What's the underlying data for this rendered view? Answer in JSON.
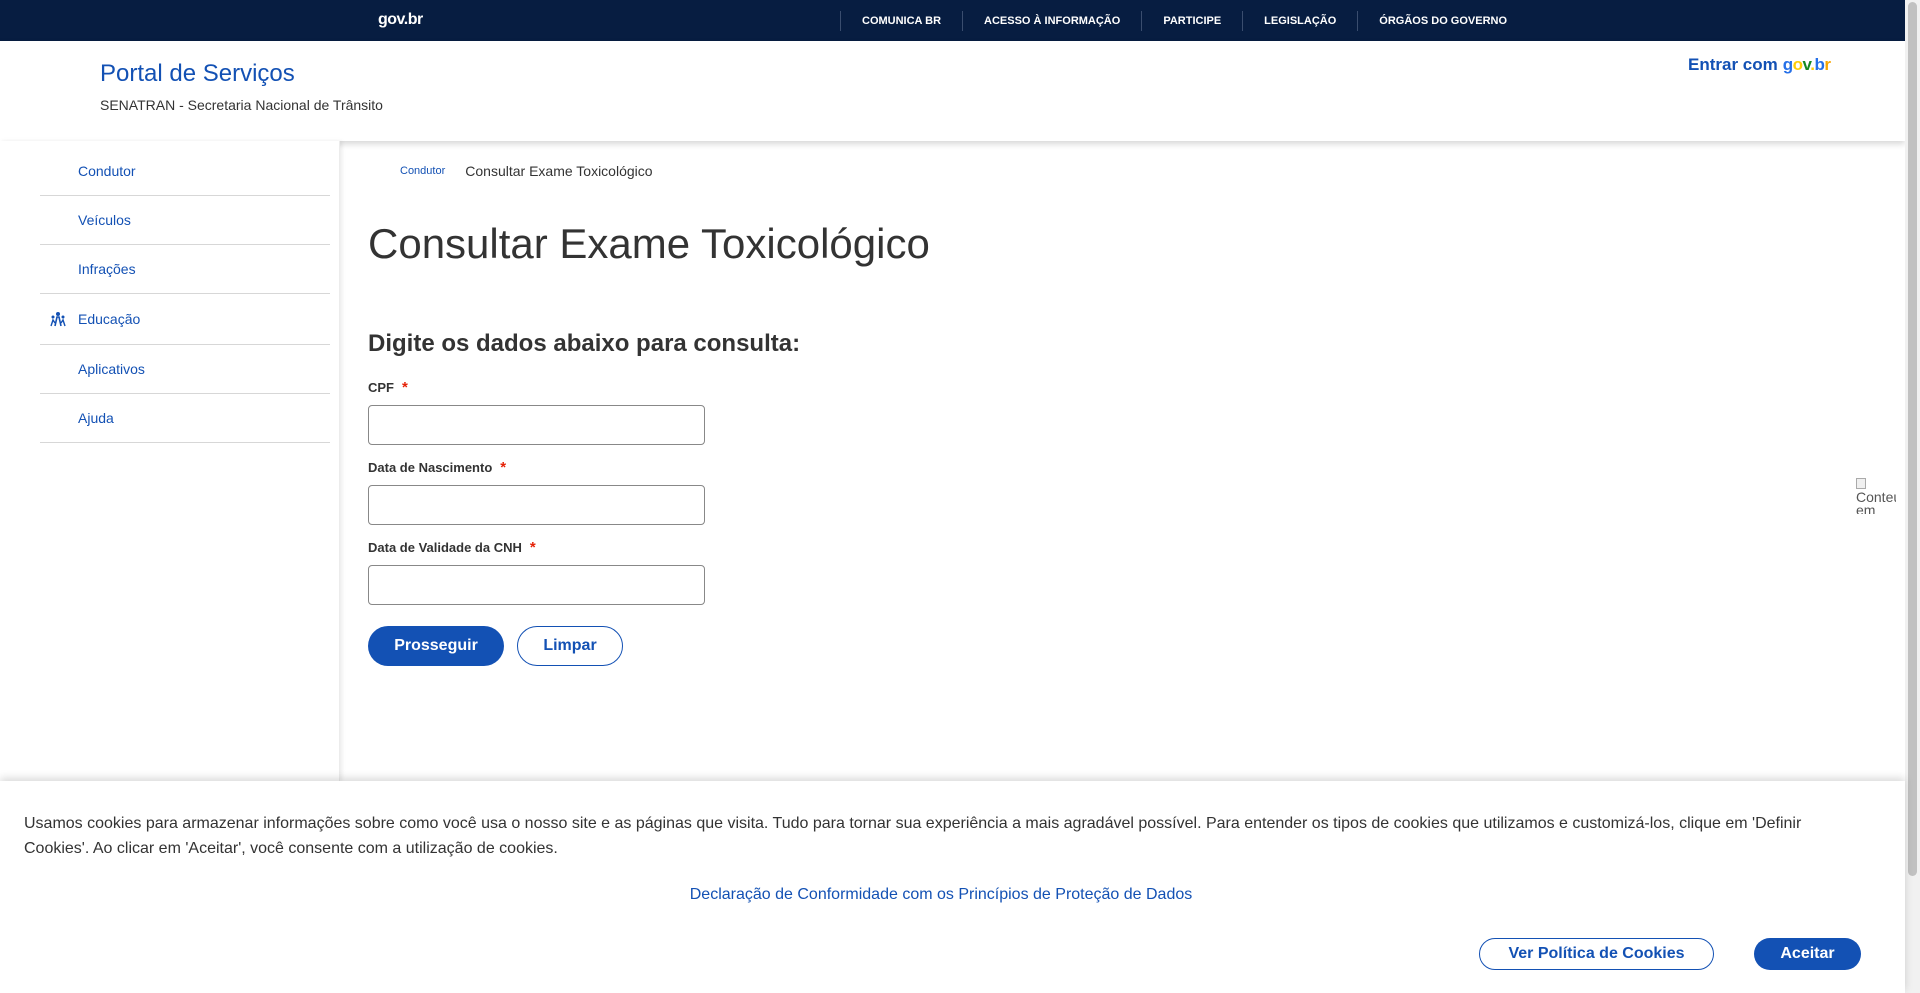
{
  "govbar": {
    "logo": "gov.br",
    "links": [
      "COMUNICA BR",
      "ACESSO À INFORMAÇÃO",
      "PARTICIPE",
      "LEGISLAÇÃO",
      "ÓRGÃOS DO GOVERNO"
    ]
  },
  "header": {
    "title": "Portal de Serviços",
    "subtitle": "SENATRAN - Secretaria Nacional de Trânsito",
    "login_prefix": "Entrar com"
  },
  "sidebar": {
    "items": [
      {
        "label": "Condutor"
      },
      {
        "label": "Veículos"
      },
      {
        "label": "Infrações"
      },
      {
        "label": "Educação",
        "icon": "people-group-icon"
      },
      {
        "label": "Aplicativos"
      },
      {
        "label": "Ajuda"
      }
    ]
  },
  "breadcrumb": {
    "parent": "Condutor",
    "current": "Consultar Exame Toxicológico"
  },
  "main": {
    "title": "Consultar Exame Toxicológico",
    "form_heading": "Digite os dados abaixo para consulta:",
    "fields": [
      {
        "label": "CPF",
        "required": "*",
        "value": "",
        "placeholder": ""
      },
      {
        "label": "Data de Nascimento",
        "required": "*",
        "value": "",
        "placeholder": ""
      },
      {
        "label": "Data de Validade da CNH",
        "required": "*",
        "value": "",
        "placeholder": ""
      }
    ],
    "submit_label": "Prosseguir",
    "clear_label": "Limpar"
  },
  "broken_image": {
    "alt_text": "Conteúdo em Libras"
  },
  "cookie": {
    "text": "Usamos cookies para armazenar informações sobre como você usa o nosso site e as páginas que visita. Tudo para tornar sua experiência a mais agradável possível. Para entender os tipos de cookies que utilizamos e customizá-los, clique em 'Definir Cookies'. Ao clicar em 'Aceitar', você consente com a utilização de cookies.",
    "link": "Declaração de Conformidade com os Princípios de Proteção de Dados",
    "policy_button": "Ver Política de Cookies",
    "accept_button": "Aceitar"
  },
  "colors": {
    "govbar_bg": "#071d41",
    "primary": "#1351b4",
    "required": "#e52207"
  }
}
